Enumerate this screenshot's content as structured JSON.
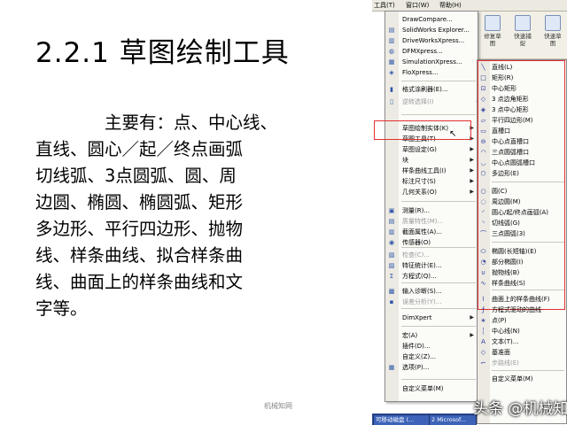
{
  "slide": {
    "title": "2.2.1 草图绘制工具",
    "body_lines": [
      "主要有：点、中心线、",
      "直线、圆心／起／终点画弧",
      "切线弧、3点圆弧、圆、周",
      "边圆、椭圆、椭圆弧、矩形",
      "多边形、平行四边形、抛物",
      "线、样条曲线、拟合样条曲",
      "线、曲面上的样条曲线和文",
      "字等。"
    ],
    "footer_small": "机械知网"
  },
  "menubar": {
    "items": [
      "工具(T)",
      "窗口(W)",
      "帮助(H)"
    ]
  },
  "toolbar": {
    "left_label": "修复草\n图",
    "mid_label": "快速捕\n捉",
    "right_label": "快速草\n图"
  },
  "menu1": {
    "items": [
      {
        "label": "DrawCompare...",
        "icon": "draw-compare-icon",
        "glyph": "",
        "arrow": false,
        "disabled": false
      },
      {
        "label": "SolidWorks Explorer...",
        "icon": "explorer-icon",
        "glyph": "▤",
        "arrow": false,
        "disabled": false
      },
      {
        "label": "DriveWorksXpress...",
        "icon": "driveworks-icon",
        "glyph": "▥",
        "arrow": false,
        "disabled": false
      },
      {
        "label": "DFMXpress...",
        "icon": "dfm-icon",
        "glyph": "◍",
        "arrow": false,
        "disabled": false
      },
      {
        "label": "SimulationXpress...",
        "icon": "simulation-icon",
        "glyph": "▦",
        "arrow": false,
        "disabled": false
      },
      {
        "label": "FloXpress...",
        "icon": "flo-icon",
        "glyph": "◈",
        "arrow": false,
        "disabled": false
      },
      {
        "label": "格式涂刷器(E)...",
        "icon": "format-painter-icon",
        "glyph": "▮",
        "arrow": false,
        "disabled": false
      },
      {
        "label": "逆转选择(I)",
        "icon": "invert-select-icon",
        "glyph": "▯",
        "arrow": false,
        "disabled": true
      },
      {
        "label": "草图绘制实体(K)",
        "icon": "sketch-entities-icon",
        "glyph": "",
        "arrow": true,
        "disabled": false
      },
      {
        "label": "草图工具(T)",
        "icon": "sketch-tools-icon",
        "glyph": "",
        "arrow": true,
        "disabled": false
      },
      {
        "label": "草图设定(G)",
        "icon": "sketch-settings-icon",
        "glyph": "",
        "arrow": true,
        "disabled": false
      },
      {
        "label": "块",
        "icon": "block-icon",
        "glyph": "",
        "arrow": true,
        "disabled": false
      },
      {
        "label": "样条曲线工具(I)",
        "icon": "spline-tools-icon",
        "glyph": "",
        "arrow": true,
        "disabled": false
      },
      {
        "label": "标注尺寸(S)",
        "icon": "dimension-icon",
        "glyph": "",
        "arrow": true,
        "disabled": false
      },
      {
        "label": "几何关系(O)",
        "icon": "relations-icon",
        "glyph": "",
        "arrow": true,
        "disabled": false
      },
      {
        "label": "测量(R)...",
        "icon": "measure-icon",
        "glyph": "▣",
        "arrow": false,
        "disabled": false
      },
      {
        "label": "质量特性(M)...",
        "icon": "mass-properties-icon",
        "glyph": "▤",
        "arrow": false,
        "disabled": true
      },
      {
        "label": "截面属性(A)...",
        "icon": "section-properties-icon",
        "glyph": "▥",
        "arrow": false,
        "disabled": false
      },
      {
        "label": "传感器(O)",
        "icon": "sensor-icon",
        "glyph": "◉",
        "arrow": false,
        "disabled": false
      },
      {
        "label": "检查(C)...",
        "icon": "check-icon",
        "glyph": "▧",
        "arrow": false,
        "disabled": true
      },
      {
        "label": "特征统计(E)...",
        "icon": "feature-statistics-icon",
        "glyph": "▨",
        "arrow": false,
        "disabled": false
      },
      {
        "label": "方程式(Q)...",
        "icon": "equations-icon",
        "glyph": "Σ",
        "arrow": false,
        "disabled": false
      },
      {
        "label": "输入诊断(S)...",
        "icon": "import-diagnostics-icon",
        "glyph": "▩",
        "arrow": false,
        "disabled": false
      },
      {
        "label": "误差分析(Y)...",
        "icon": "deviation-analysis-icon",
        "glyph": "▪",
        "arrow": false,
        "disabled": true
      },
      {
        "label": "DimXpert",
        "icon": "dimxpert-icon",
        "glyph": "",
        "arrow": true,
        "disabled": false
      },
      {
        "label": "宏(A)",
        "icon": "macro-icon",
        "glyph": "",
        "arrow": true,
        "disabled": false
      },
      {
        "label": "插件(D)...",
        "icon": "addins-icon",
        "glyph": "",
        "arrow": false,
        "disabled": false
      },
      {
        "label": "自定义(Z)...",
        "icon": "customize-icon",
        "glyph": "",
        "arrow": false,
        "disabled": false
      },
      {
        "label": "选项(P)...",
        "icon": "options-icon",
        "glyph": "▦",
        "arrow": false,
        "disabled": false
      },
      {
        "label": "自定义菜单(M)",
        "icon": "customize-menu-icon",
        "glyph": "",
        "arrow": false,
        "disabled": false
      }
    ]
  },
  "submenu": {
    "items": [
      {
        "label": "直线(L)",
        "icon": "line-icon",
        "glyph": "╲",
        "disabled": false
      },
      {
        "label": "矩形(R)",
        "icon": "rectangle-icon",
        "glyph": "□",
        "disabled": false
      },
      {
        "label": "中心矩形",
        "icon": "center-rectangle-icon",
        "glyph": "⊡",
        "disabled": false
      },
      {
        "label": "3 点边角矩形",
        "icon": "three-point-corner-rectangle-icon",
        "glyph": "◇",
        "disabled": false
      },
      {
        "label": "3 点中心矩形",
        "icon": "three-point-center-rectangle-icon",
        "glyph": "◈",
        "disabled": false
      },
      {
        "label": "平行四边形(M)",
        "icon": "parallelogram-icon",
        "glyph": "▱",
        "disabled": false
      },
      {
        "label": "直槽口",
        "icon": "straight-slot-icon",
        "glyph": "▭",
        "disabled": false
      },
      {
        "label": "中心点直槽口",
        "icon": "centerpoint-straight-slot-icon",
        "glyph": "⊖",
        "disabled": false
      },
      {
        "label": "三点圆弧槽口",
        "icon": "three-point-arc-slot-icon",
        "glyph": "◠",
        "disabled": false
      },
      {
        "label": "中心点圆弧槽口",
        "icon": "centerpoint-arc-slot-icon",
        "glyph": "◡",
        "disabled": false
      },
      {
        "label": "多边形(E)",
        "icon": "polygon-icon",
        "glyph": "⬡",
        "disabled": false
      },
      {
        "label": "圆(C)",
        "icon": "circle-icon",
        "glyph": "○",
        "disabled": false
      },
      {
        "label": "周边圆(M)",
        "icon": "perimeter-circle-icon",
        "glyph": "◌",
        "disabled": false
      },
      {
        "label": "圆心/起/终点画弧(A)",
        "icon": "centerpoint-arc-icon",
        "glyph": "◜",
        "disabled": false
      },
      {
        "label": "切线弧(G)",
        "icon": "tangent-arc-icon",
        "glyph": "◝",
        "disabled": false
      },
      {
        "label": "三点圆弧(3)",
        "icon": "three-point-arc-icon",
        "glyph": "⌒",
        "disabled": false
      },
      {
        "label": "椭圆(长短轴)(E)",
        "icon": "ellipse-icon",
        "glyph": "⬭",
        "disabled": false
      },
      {
        "label": "部分椭圆(I)",
        "icon": "partial-ellipse-icon",
        "glyph": "◔",
        "disabled": false
      },
      {
        "label": "抛物线(B)",
        "icon": "parabola-icon",
        "glyph": "∪",
        "disabled": false
      },
      {
        "label": "样条曲线(S)",
        "icon": "spline-icon",
        "glyph": "∿",
        "disabled": false
      },
      {
        "label": "曲面上的样条曲线(F)",
        "icon": "spline-on-surface-icon",
        "glyph": "⌇",
        "disabled": false
      },
      {
        "label": "方程式驱动的曲线",
        "icon": "equation-driven-curve-icon",
        "glyph": "ƒ",
        "disabled": false
      },
      {
        "label": "点(P)",
        "icon": "point-icon",
        "glyph": "∗",
        "disabled": false
      },
      {
        "label": "中心线(N)",
        "icon": "centerline-icon",
        "glyph": "┆",
        "disabled": false
      },
      {
        "label": "文本(T)...",
        "icon": "text-icon",
        "glyph": "A",
        "disabled": false
      },
      {
        "label": "基准面",
        "icon": "plane-icon",
        "glyph": "◇",
        "disabled": false
      },
      {
        "label": "步路线(E)",
        "icon": "route-line-icon",
        "glyph": "⌐",
        "disabled": true
      },
      {
        "label": "自定义菜单(M)",
        "icon": "customize-menu-icon",
        "glyph": "",
        "disabled": false
      }
    ]
  },
  "taskbar": {
    "items": [
      "可移动磁盘 (...",
      "2 Microsof..."
    ]
  },
  "watermark": "头条 @机械知网",
  "colors": {
    "highlight_red": "#e03030",
    "menu_bg": "#fbfbf8",
    "gutter": "#eceae3",
    "taskbar": "#2f4e9a"
  }
}
